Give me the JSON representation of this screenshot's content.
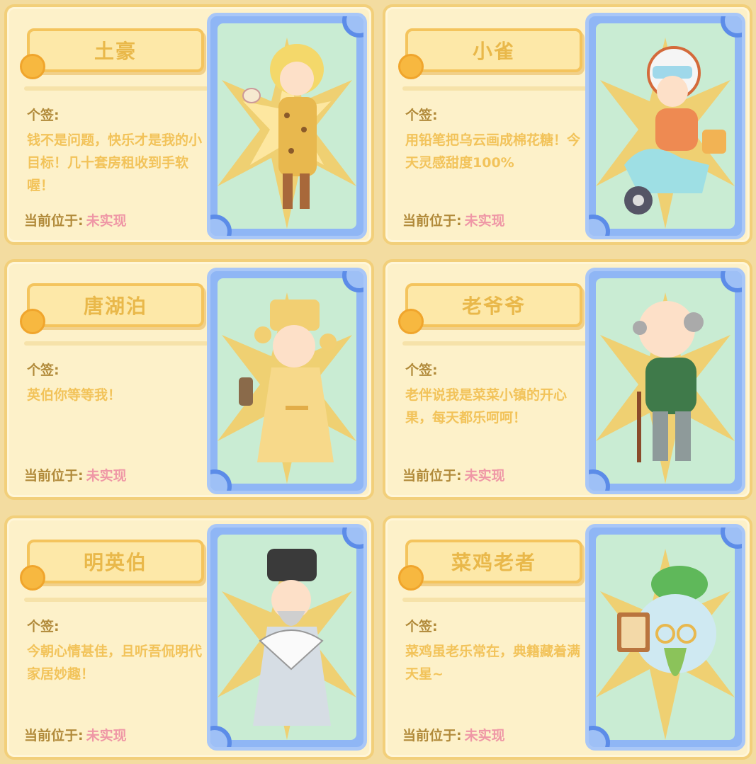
{
  "labels": {
    "signature": "个签:",
    "location": "当前位于:"
  },
  "cards": [
    {
      "name": "土豪",
      "signature": "钱不是问题，快乐才是我的小目标！几十套房租收到手软喔！",
      "location": "未实现",
      "character_icon": "rich-man-icon"
    },
    {
      "name": "小雀",
      "signature": "用铅笔把乌云画成棉花糖！今天灵感甜度100%",
      "location": "未实现",
      "character_icon": "scooter-girl-icon"
    },
    {
      "name": "唐湖泊",
      "signature": "英伯你等等我！",
      "location": "未实现",
      "character_icon": "scholar-icon"
    },
    {
      "name": "老爷爷",
      "signature": "老伴说我是菜菜小镇的开心果，每天都乐呵呵！",
      "location": "未实现",
      "character_icon": "grandpa-icon"
    },
    {
      "name": "明英伯",
      "signature": "今朝心情甚佳，且听吾侃明代家居妙趣！",
      "location": "未实现",
      "character_icon": "ming-elder-icon"
    },
    {
      "name": "菜鸡老者",
      "signature": "菜鸡虽老乐常在，典籍藏着满天星~",
      "location": "未实现",
      "character_icon": "vegetable-elder-icon"
    }
  ],
  "colors": {
    "card_bg": "#fdf1c9",
    "name_text": "#e9b84a",
    "label_text": "#b18a3a",
    "location_value": "#ef97a6",
    "frame_blue": "#8fb6f5"
  }
}
